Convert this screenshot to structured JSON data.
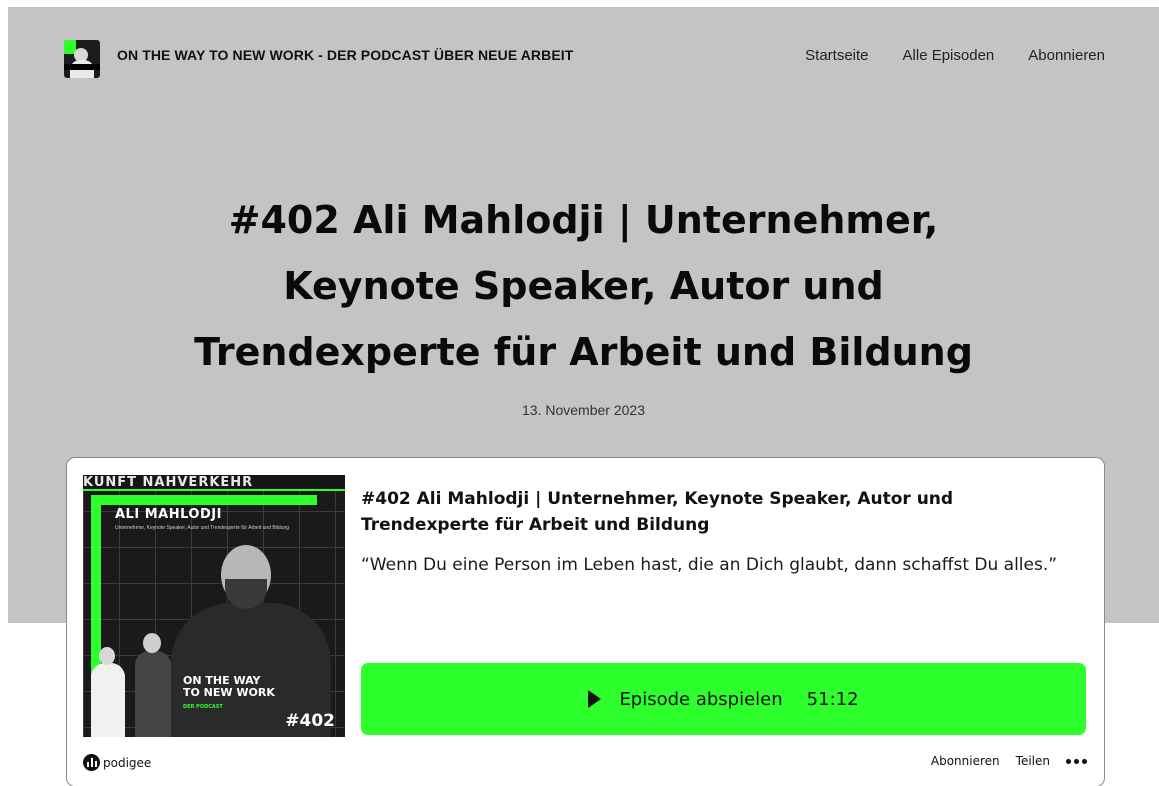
{
  "site": {
    "title": "ON THE WAY TO NEW WORK - DER PODCAST ÜBER NEUE ARBEIT",
    "logo_icon": "podcast-cover-thumbnail"
  },
  "nav": {
    "items": [
      {
        "label": "Startseite"
      },
      {
        "label": "Alle Episoden"
      },
      {
        "label": "Abonnieren"
      }
    ]
  },
  "episode": {
    "headline_lines": [
      "#402 Ali Mahlodji | Unternehmer,",
      "Keynote Speaker, Autor und",
      "Trendexperte für Arbeit und Bildung"
    ],
    "date": "13. November 2023"
  },
  "player": {
    "title": "#402 Ali Mahlodji | Unternehmer, Keynote Speaker, Autor und Trendexperte für Arbeit und Bildung",
    "quote": "“Wenn Du eine Person im Leben hast, die an Dich glaubt, dann schaffst Du alles.”",
    "play_label": "Episode abspielen",
    "duration": "51:12",
    "accent_color": "#2cff2c",
    "cover": {
      "name": "ALI MAHLODJI",
      "subtitle": "Unternehmer, Keynote Speaker, Autor und Trendexperte für Arbeit und Bildung",
      "top_text": "KUNFT NAHVERKEHR",
      "show_line1": "ON THE WAY",
      "show_line2": "TO NEW WORK",
      "show_line3": "DER PODCAST",
      "episode_number": "#402"
    },
    "footer": {
      "brand": "podigee",
      "subscribe_label": "Abonnieren",
      "share_label": "Teilen",
      "more_icon": "more-dots-icon"
    }
  }
}
